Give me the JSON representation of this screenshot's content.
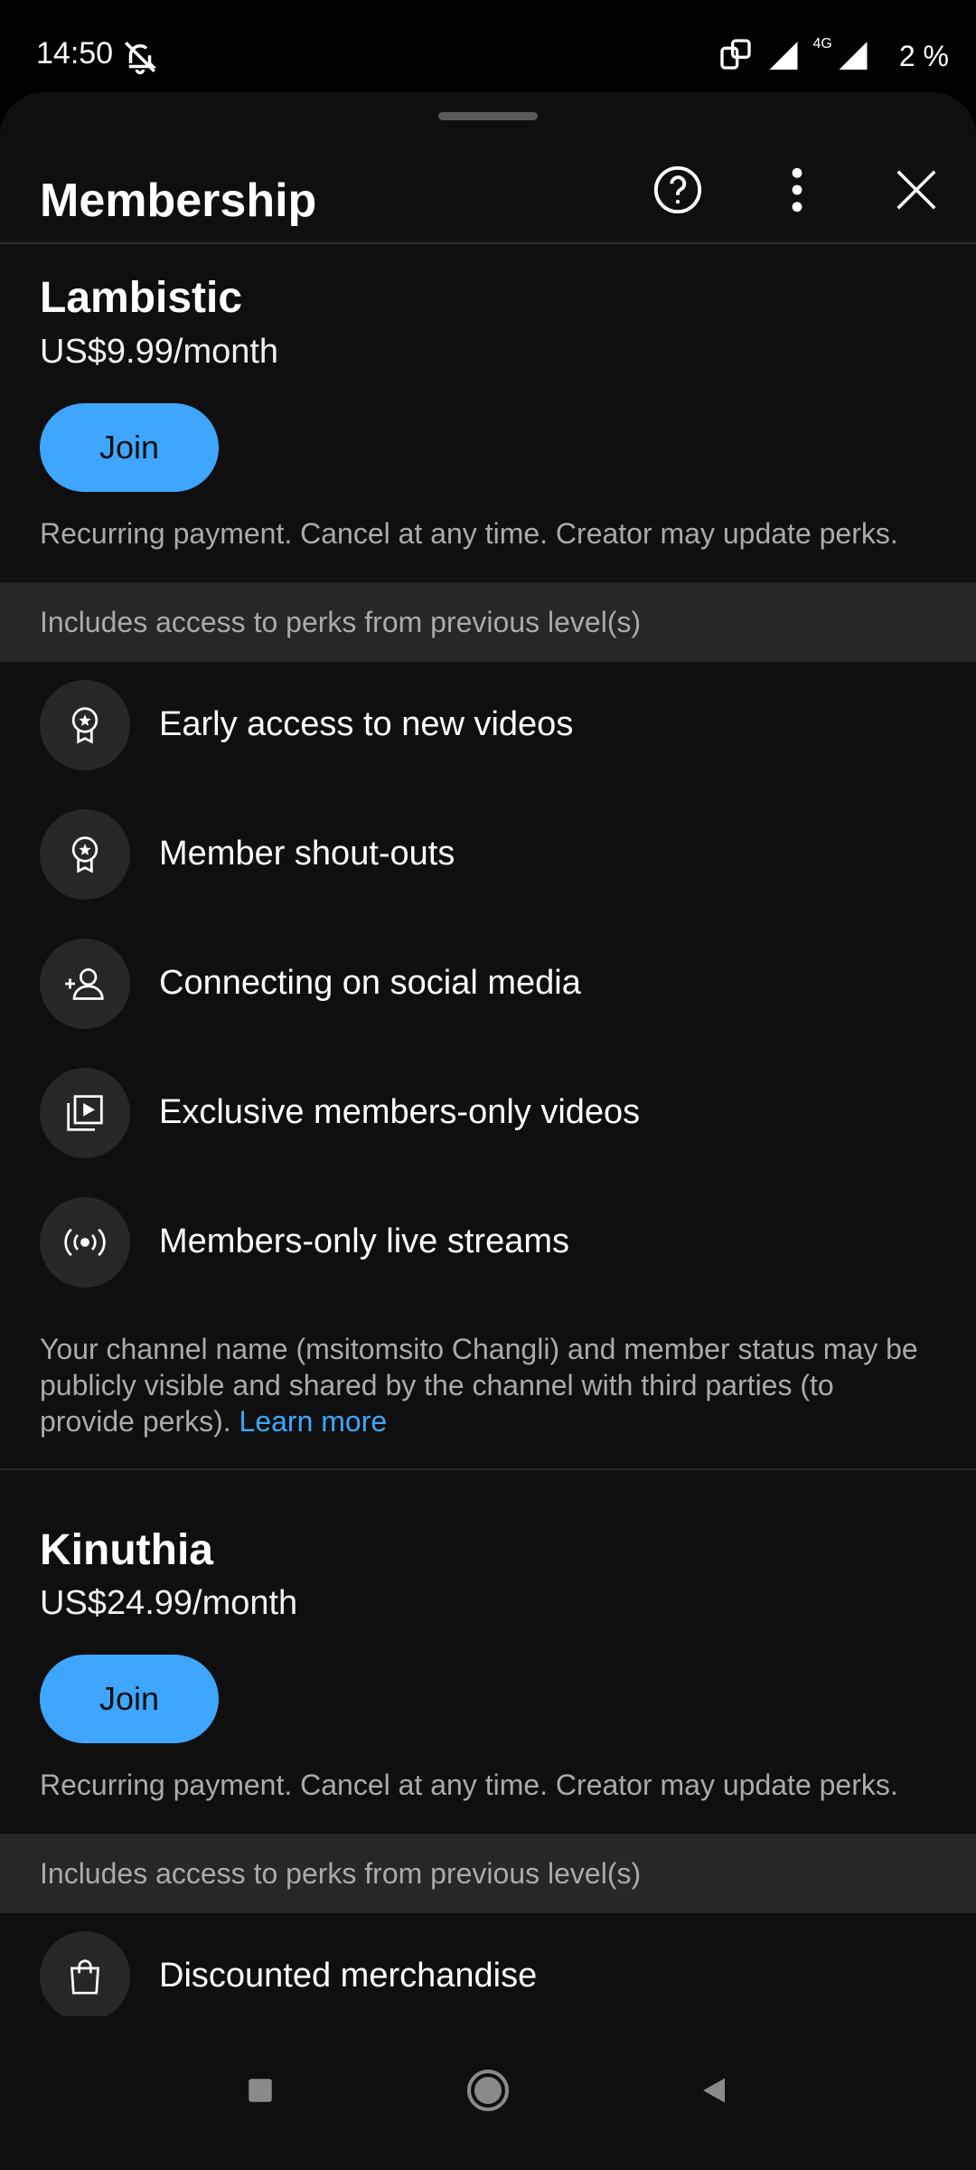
{
  "status": {
    "time": "14:50",
    "network": "4G",
    "battery": "2 %"
  },
  "header": {
    "title": "Membership"
  },
  "icons": {
    "help": "help-circle-icon",
    "more": "more-vert-icon",
    "close": "close-icon",
    "badge": "badge-icon",
    "person_add": "person-add-icon",
    "video": "video-library-icon",
    "live": "live-stream-icon",
    "bag": "shopping-bag-icon"
  },
  "colors": {
    "accent": "#3ea6ff",
    "sheet": "#0f0f0f",
    "band": "#272727",
    "muted": "#aaaaaa"
  },
  "tiers": [
    {
      "name": "Lambistic",
      "price": "US$9.99/month",
      "join_label": "Join",
      "note": "Recurring payment. Cancel at any time. Creator may update perks.",
      "band": "Includes access to perks from previous level(s)",
      "perks": [
        "Early access to new videos",
        "Member shout-outs",
        "Connecting on social media",
        "Exclusive members-only videos",
        "Members-only live streams"
      ]
    },
    {
      "name": "Kinuthia",
      "price": "US$24.99/month",
      "join_label": "Join",
      "note": "Recurring payment. Cancel at any time. Creator may update perks.",
      "band": "Includes access to perks from previous level(s)",
      "perks": [
        "Discounted merchandise"
      ]
    }
  ],
  "privacy": {
    "text": "Your channel name (msitomsito Changli) and member status may be publicly visible and shared by the channel with third parties (to provide perks).",
    "link": "Learn more"
  }
}
